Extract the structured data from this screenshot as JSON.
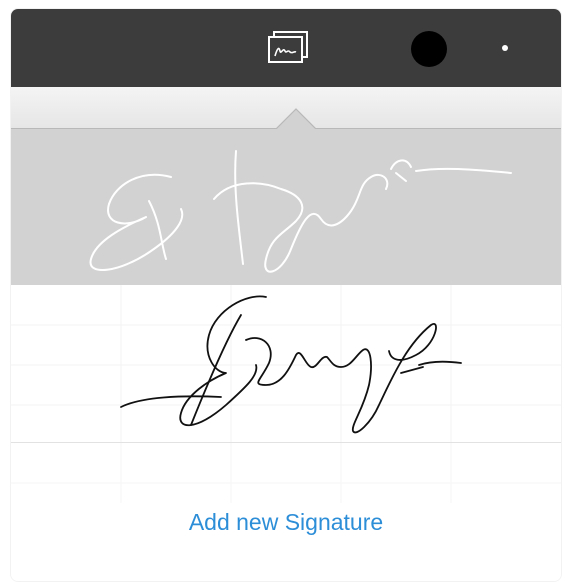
{
  "toolbar": {
    "icons": [
      "signature-tool-icon",
      "color-swatch",
      "more-dot"
    ],
    "ink_color": "#000000",
    "background": "#3c3c3c"
  },
  "signatures": [
    {
      "selected": true,
      "stroke_color": "#ffffff"
    },
    {
      "selected": false,
      "stroke_color": "#111111"
    }
  ],
  "add_button": {
    "label": "Add new Signature",
    "color": "#2d8ed8"
  },
  "colors": {
    "selected_row": "#d2d2d2",
    "accent": "#2d8ed8"
  }
}
